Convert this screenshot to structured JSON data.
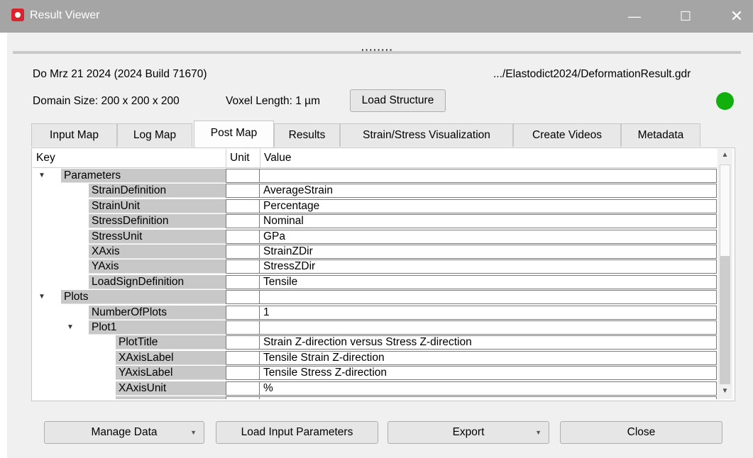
{
  "window": {
    "title": "Result Viewer"
  },
  "header": {
    "date_build": "Do Mrz 21 2024 (2024 Build 71670)",
    "file_path": ".../Elastodict2024/DeformationResult.gdr",
    "domain_size": "Domain Size: 200 x 200 x 200",
    "voxel_length": "Voxel Length: 1 µm",
    "load_structure": "Load Structure",
    "status_color": "#11b00d"
  },
  "tabs": [
    {
      "label": "Input Map"
    },
    {
      "label": "Log Map"
    },
    {
      "label": "Post Map",
      "active": true
    },
    {
      "label": "Results"
    },
    {
      "label": "Strain/Stress Visualization"
    },
    {
      "label": "Create Videos"
    },
    {
      "label": "Metadata"
    }
  ],
  "tree": {
    "columns": {
      "key": "Key",
      "unit": "Unit",
      "value": "Value"
    },
    "rows": [
      {
        "key": "Parameters",
        "value": "",
        "level": 0,
        "expanded": true
      },
      {
        "key": "StrainDefinition",
        "value": "AverageStrain",
        "level": 1
      },
      {
        "key": "StrainUnit",
        "value": "Percentage",
        "level": 1
      },
      {
        "key": "StressDefinition",
        "value": "Nominal",
        "level": 1
      },
      {
        "key": "StressUnit",
        "value": "GPa",
        "level": 1
      },
      {
        "key": "XAxis",
        "value": "StrainZDir",
        "level": 1
      },
      {
        "key": "YAxis",
        "value": "StressZDir",
        "level": 1
      },
      {
        "key": "LoadSignDefinition",
        "value": "Tensile",
        "level": 1
      },
      {
        "key": "Plots",
        "value": "",
        "level": 0,
        "expanded": true
      },
      {
        "key": "NumberOfPlots",
        "value": "1",
        "level": 1
      },
      {
        "key": "Plot1",
        "value": "",
        "level": 1,
        "expanded": true
      },
      {
        "key": "PlotTitle",
        "value": "Strain Z-direction versus Stress Z-direction",
        "level": 2
      },
      {
        "key": "XAxisLabel",
        "value": "Tensile Strain Z-direction",
        "level": 2
      },
      {
        "key": "YAxisLabel",
        "value": "Tensile Stress Z-direction",
        "level": 2
      },
      {
        "key": "XAxisUnit",
        "value": "%",
        "level": 2
      },
      {
        "key": "",
        "value": "",
        "level": 2
      }
    ]
  },
  "footer": {
    "manage_data": "Manage Data",
    "load_input": "Load Input Parameters",
    "export": "Export",
    "close": "Close"
  }
}
